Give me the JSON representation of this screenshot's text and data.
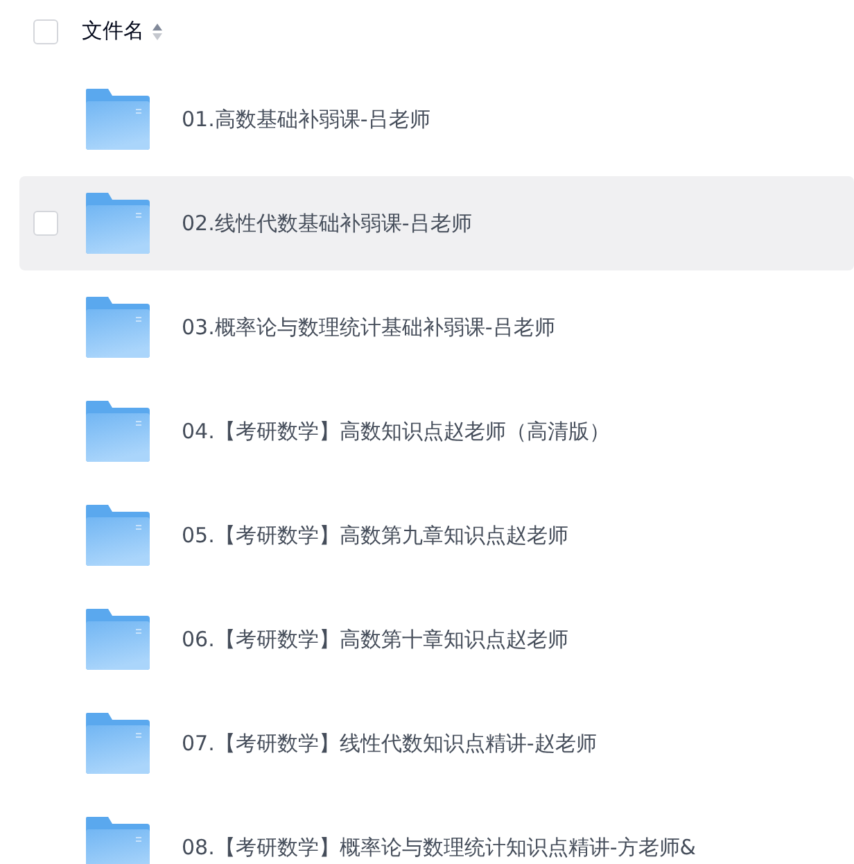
{
  "header": {
    "label": "文件名",
    "checked": false
  },
  "rows": [
    {
      "name": "01.高数基础补弱课-吕老师",
      "hovered": false
    },
    {
      "name": "02.线性代数基础补弱课-吕老师",
      "hovered": true
    },
    {
      "name": "03.概率论与数理统计基础补弱课-吕老师",
      "hovered": false
    },
    {
      "name": "04.【考研数学】高数知识点赵老师（高清版）",
      "hovered": false
    },
    {
      "name": "05.【考研数学】高数第九章知识点赵老师",
      "hovered": false
    },
    {
      "name": "06.【考研数学】高数第十章知识点赵老师",
      "hovered": false
    },
    {
      "name": "07.【考研数学】线性代数知识点精讲-赵老师",
      "hovered": false
    },
    {
      "name": "08.【考研数学】概率论与数理统计知识点精讲-方老师&",
      "hovered": false
    }
  ]
}
